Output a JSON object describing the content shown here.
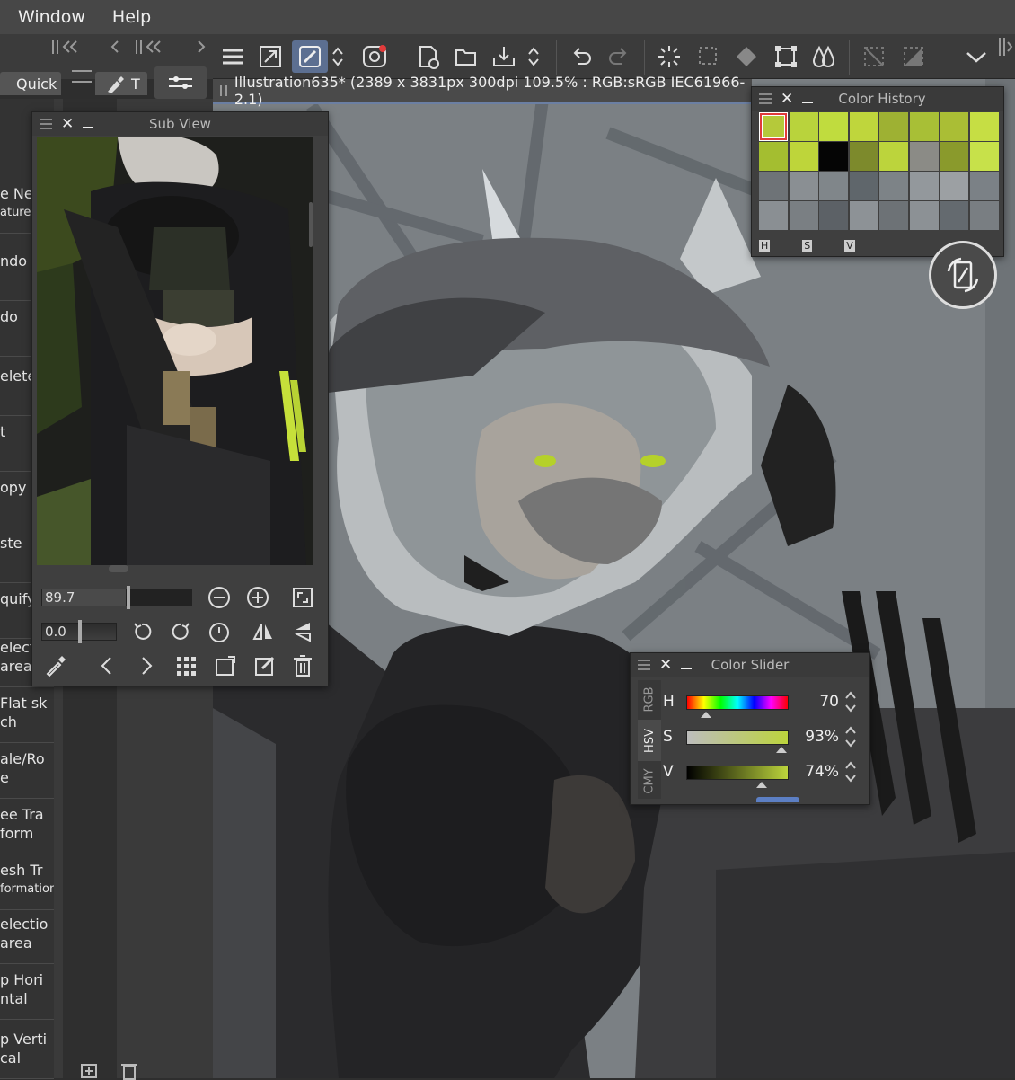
{
  "menu": {
    "window": "Window",
    "help": "Help"
  },
  "left_tabs": {
    "quick": "Quick",
    "tool_glyph": "T"
  },
  "left_items": [
    {
      "label": "e Ne",
      "sub": "atures"
    },
    {
      "label": "ndo",
      "sub": ""
    },
    {
      "label": "do",
      "sub": ""
    },
    {
      "label": "elete",
      "sub": ""
    },
    {
      "label": "t",
      "sub": ""
    },
    {
      "label": "opy",
      "sub": ""
    },
    {
      "label": "ste",
      "sub": ""
    },
    {
      "label": "quify",
      "sub": ""
    },
    {
      "label": "electio",
      "sub": "area"
    },
    {
      "label": "Flat sk",
      "sub": "ch"
    },
    {
      "label": "ale/Ro",
      "sub": "e"
    },
    {
      "label": "ee Tra",
      "sub": "form"
    },
    {
      "label": "esh Tr",
      "sub": "formation"
    },
    {
      "label": "electio",
      "sub": "area"
    },
    {
      "label": "p Hori",
      "sub": "ntal"
    },
    {
      "label": "p Verti",
      "sub": "cal"
    }
  ],
  "document_tab": {
    "title": "Illustration635* (2389 x 3831px 300dpi 109.5% : RGB:sRGB IEC61966-2.1)"
  },
  "subview": {
    "title": "Sub View",
    "zoom_value": "89.7",
    "rotation_value": "0.0"
  },
  "color_history": {
    "title": "Color History",
    "tabs": [
      "H",
      "S",
      "V"
    ],
    "swatches": [
      "#b5c93a",
      "#b9d33c",
      "#c0dc3e",
      "#bfd63c",
      "#9eb133",
      "#a8bf36",
      "#aabe35",
      "#c6de44",
      "#a4be30",
      "#bed53a",
      "#050505",
      "#7d8a2c",
      "#bcd43c",
      "#8b8b86",
      "#8a9a2c",
      "#c7e14a",
      "#6e7377",
      "#8a8f93",
      "#80868a",
      "#5f666b",
      "#7d8387",
      "#93989c",
      "#9ca0a3",
      "#7b8186",
      "#8a8f93",
      "#7a7f83",
      "#5c6166",
      "#8d9296",
      "#6d7276",
      "#8c9195",
      "#646a6f",
      "#797e82"
    ]
  },
  "color_slider": {
    "title": "Color Slider",
    "tabs": [
      "RGB",
      "HSV",
      "CMY"
    ],
    "rows": [
      {
        "label": "H",
        "value": "70"
      },
      {
        "label": "S",
        "value": "93%"
      },
      {
        "label": "V",
        "value": "74%"
      }
    ],
    "h_level": 70,
    "s_level": 0.93,
    "v_level": 0.74,
    "accent": "#bcd43c"
  },
  "colors": {
    "active_tool": "#5c6f91",
    "accent_lime": "#c4dd3a"
  }
}
